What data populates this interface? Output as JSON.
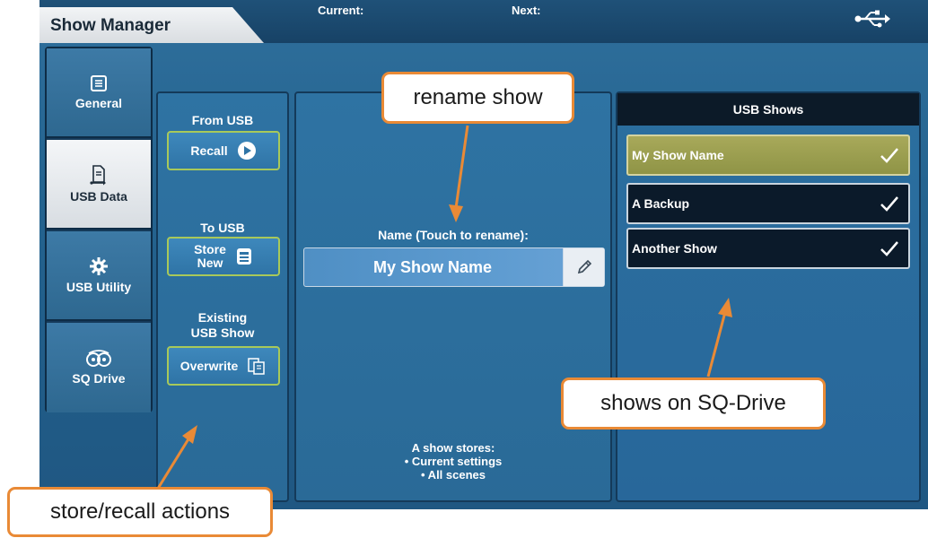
{
  "header": {
    "title": "Show Manager",
    "current_label": "Current:",
    "next_label": "Next:",
    "usb_icon": "usb-icon"
  },
  "sidebar": {
    "items": [
      {
        "label": "General",
        "icon": "document-icon",
        "active": false
      },
      {
        "label": "USB Data",
        "icon": "usb-document-icon",
        "active": true
      },
      {
        "label": "USB Utility",
        "icon": "gear-icon",
        "active": false
      },
      {
        "label": "SQ Drive",
        "icon": "sq-drive-icon",
        "active": false
      }
    ]
  },
  "actions": {
    "from_usb_label": "From USB",
    "recall_label": "Recall",
    "to_usb_label": "To USB",
    "store_line1": "Store",
    "store_line2": "New",
    "existing_line1": "Existing",
    "existing_line2": "USB Show",
    "overwrite_label": "Overwrite"
  },
  "name_section": {
    "label": "Name (Touch to rename):",
    "value": "My Show Name",
    "edit_icon": "pencil-icon"
  },
  "info": {
    "line1": "A show stores:",
    "line2": "• Current settings",
    "line3": "• All scenes"
  },
  "usb_shows": {
    "header": "USB Shows",
    "items": [
      {
        "name": "My Show Name",
        "selected": true
      },
      {
        "name": "A Backup",
        "selected": false
      },
      {
        "name": "Another Show",
        "selected": false
      }
    ]
  },
  "callouts": {
    "rename": "rename show",
    "shows": "shows on SQ-Drive",
    "actions": "store/recall actions"
  },
  "colors": {
    "accent_orange": "#e98a36",
    "selected_item": "#a8a95a",
    "button_border": "#a8c95a"
  }
}
